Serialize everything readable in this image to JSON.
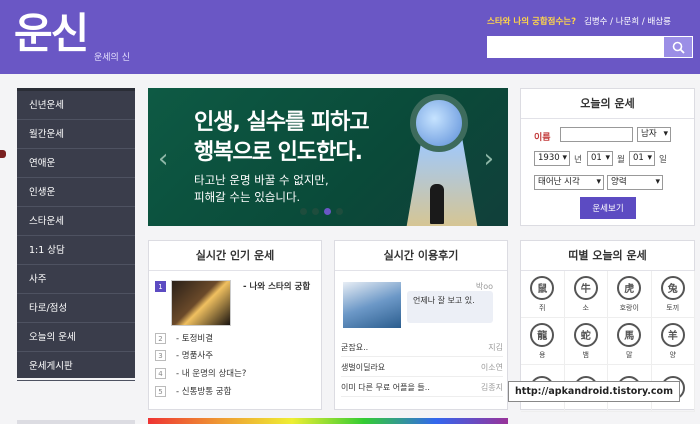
{
  "header": {
    "logo": "운신",
    "logo_sub": "운세의 신",
    "question": "스타와 나의 궁합점수는?",
    "links": "김병수 / 나문희 / 배삼룡",
    "search_placeholder": ""
  },
  "sidebar": {
    "items": [
      {
        "label": "신년운세"
      },
      {
        "label": "월간운세"
      },
      {
        "label": "연애운"
      },
      {
        "label": "인생운"
      },
      {
        "label": "스타운세"
      },
      {
        "label": "1:1 상담"
      },
      {
        "label": "사주"
      },
      {
        "label": "타로/점성"
      },
      {
        "label": "오늘의 운세"
      },
      {
        "label": "운세게시판"
      }
    ]
  },
  "banner": {
    "headline1": "인생, 실수를 피하고",
    "headline2": "행복으로 인도한다.",
    "sub1": "타고난 운명 바꿀 수 없지만,",
    "sub2": "피해갈 수는 있습니다.",
    "slides": 4,
    "active_slide": 3
  },
  "fortune": {
    "title": "오늘의 운세",
    "name_label": "이름",
    "gender": "남자",
    "year": "1930",
    "year_unit": "년",
    "month": "01",
    "month_unit": "월",
    "day": "01",
    "day_unit": "일",
    "birth_time": "태어난 시각",
    "calendar": "양력",
    "submit": "운세보기"
  },
  "popular": {
    "title": "실시간 인기 운세",
    "items": [
      {
        "num": "1",
        "text": "- 나와 스타의 궁합"
      },
      {
        "num": "2",
        "text": "- 토정비결"
      },
      {
        "num": "3",
        "text": "- 명품사주"
      },
      {
        "num": "4",
        "text": "- 내 운명의 상대는?"
      },
      {
        "num": "5",
        "text": "- 신통방통 궁합"
      }
    ]
  },
  "review": {
    "title": "실시간 이용후기",
    "bubble_text": "언제나 잘 보고 있.",
    "bubble_id": "박oo",
    "rows": [
      {
        "text": "굳잡요..",
        "writer": "지김"
      },
      {
        "text": "생벌이딜라요",
        "writer": "이소연"
      },
      {
        "text": "이미 다른 무료 어플을 들..",
        "writer": "김종지"
      }
    ]
  },
  "zodiac": {
    "title": "띠별 오늘의 운세",
    "animals": [
      {
        "label": "쥐",
        "glyph": "鼠"
      },
      {
        "label": "소",
        "glyph": "牛"
      },
      {
        "label": "호랑이",
        "glyph": "虎"
      },
      {
        "label": "토끼",
        "glyph": "兔"
      },
      {
        "label": "용",
        "glyph": "龍"
      },
      {
        "label": "뱀",
        "glyph": "蛇"
      },
      {
        "label": "말",
        "glyph": "馬"
      },
      {
        "label": "양",
        "glyph": "羊"
      },
      {
        "label": "",
        "glyph": "猴"
      },
      {
        "label": "",
        "glyph": "鷄"
      },
      {
        "label": "",
        "glyph": "犬"
      },
      {
        "label": "",
        "glyph": "猪"
      }
    ]
  },
  "watermark": "http://apkandroid.tistory.com",
  "colors": {
    "brand": "#6a57c5",
    "sidebar": "#3a3d4b",
    "banner": "#0e5a44",
    "accent_yellow": "#ffd54a"
  }
}
